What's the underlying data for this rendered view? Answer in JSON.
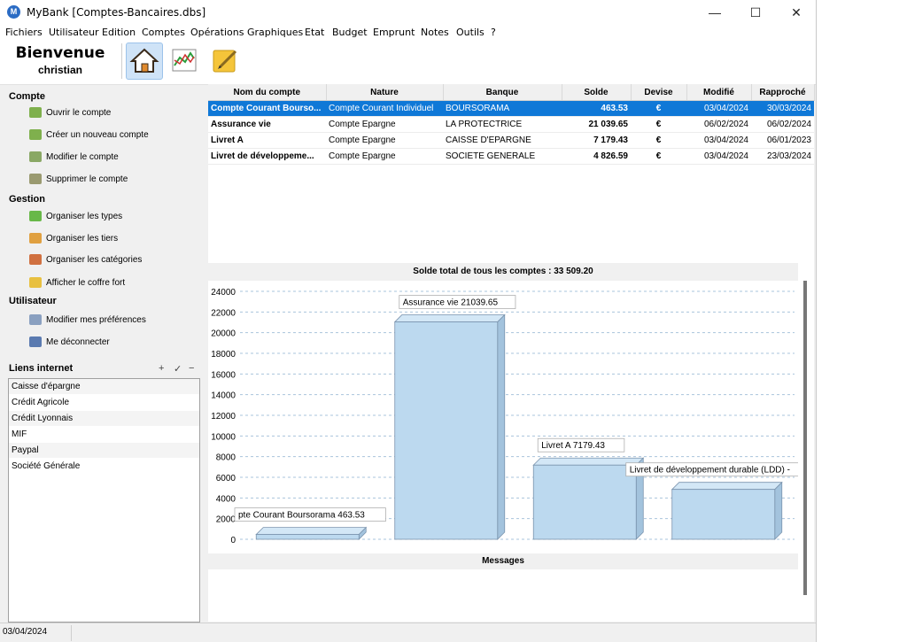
{
  "window": {
    "title": "MyBank [Comptes-Bancaires.dbs]",
    "controls": {
      "minimize": "—",
      "maximize": "☐",
      "close": "✕"
    }
  },
  "menu": [
    "Fichiers",
    "Utilisateur",
    "Edition",
    "Comptes",
    "Opérations",
    "Graphiques",
    "Etat",
    "Budget",
    "Emprunt",
    "Notes",
    "Outils",
    "?"
  ],
  "header": {
    "welcome": "Bienvenue",
    "user": "christian"
  },
  "toolbar": {
    "icons": [
      "home-icon",
      "chart-icon",
      "notes-icon"
    ],
    "selected": "home-icon"
  },
  "sidebar": {
    "compte": {
      "title": "Compte",
      "items": [
        "Ouvrir le compte",
        "Créer un nouveau compte",
        "Modifier le compte",
        "Supprimer le compte"
      ]
    },
    "gestion": {
      "title": "Gestion",
      "items": [
        "Organiser les types",
        "Organiser les tiers",
        "Organiser les catégories",
        "Afficher le coffre fort"
      ]
    },
    "utilisateur": {
      "title": "Utilisateur",
      "items": [
        "Modifier mes préférences",
        "Me déconnecter"
      ]
    },
    "links": {
      "title": "Liens internet",
      "controls": [
        "+",
        "✓",
        "−"
      ],
      "items": [
        "Caisse d'épargne",
        "Crédit Agricole",
        "Crédit Lyonnais",
        "MIF",
        "Paypal",
        "Société Générale"
      ]
    }
  },
  "accounts": {
    "headers": [
      "Nom du compte",
      "Nature",
      "Banque",
      "Solde",
      "Devise",
      "Modifié",
      "Rapproché"
    ],
    "rows": [
      {
        "name": "Compte Courant Bourso...",
        "nature": "Compte Courant Individuel",
        "bank": "BOURSORAMA",
        "balance": "463.53",
        "currency": "€",
        "modified": "03/04/2024",
        "reconciled": "30/03/2024",
        "selected": true
      },
      {
        "name": "Assurance vie",
        "nature": "Compte Epargne",
        "bank": "LA PROTECTRICE",
        "balance": "21 039.65",
        "currency": "€",
        "modified": "06/02/2024",
        "reconciled": "06/02/2024",
        "selected": false
      },
      {
        "name": "Livret A",
        "nature": "Compte Epargne",
        "bank": "CAISSE D'EPARGNE",
        "balance": "7 179.43",
        "currency": "€",
        "modified": "03/04/2024",
        "reconciled": "06/01/2023",
        "selected": false
      },
      {
        "name": "Livret de développeme...",
        "nature": "Compte Epargne",
        "bank": "SOCIETE GENERALE",
        "balance": "4 826.59",
        "currency": "€",
        "modified": "03/04/2024",
        "reconciled": "23/03/2024",
        "selected": false
      }
    ]
  },
  "chart_data": {
    "type": "bar",
    "title": "Solde total de tous les comptes : 33 509.20",
    "categories": [
      "Compte Courant Boursorama",
      "Assurance vie",
      "Livret A",
      "Livret de développement durable (LDD)"
    ],
    "values": [
      463.53,
      21039.65,
      7179.43,
      4826.59
    ],
    "data_labels": [
      "pte Courant Boursorama 463.53",
      "Assurance vie 21039.65",
      "Livret A 7179.43",
      "Livret de développement durable (LDD) -"
    ],
    "ylim": [
      0,
      24000
    ],
    "yticks": [
      "0",
      "2000",
      "4000",
      "6000",
      "8000",
      "10000",
      "12000",
      "14000",
      "16000",
      "18000",
      "20000",
      "22000",
      "24000"
    ],
    "grid": true,
    "bar_color": "#bcd9ef"
  },
  "messages": {
    "title": "Messages"
  },
  "status": {
    "date": "03/04/2024"
  }
}
